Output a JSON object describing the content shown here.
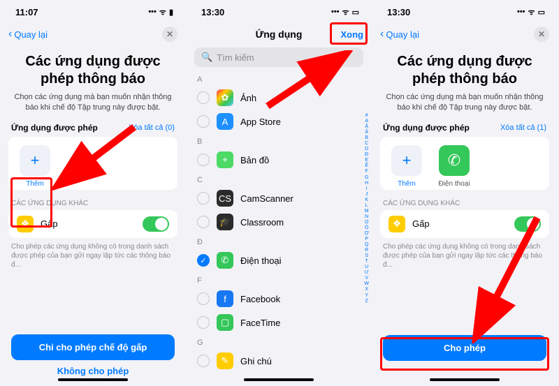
{
  "screen1": {
    "time": "11:07",
    "back": "Quay lại",
    "title": "Các ứng dụng được phép thông báo",
    "subtitle": "Chọn các ứng dụng mà bạn muốn nhận thông báo khi chế độ Tập trung này được bật.",
    "allowed_label": "Ứng dụng được phép",
    "clear_all": "Xóa tất cả (0)",
    "add_label": "Thêm",
    "other_apps": "CÁC ỨNG DỤNG KHÁC",
    "gap_label": "Gấp",
    "footnote": "Cho phép các ứng dụng không có trong danh sách được phép của bạn gửi ngay lập tức các thông báo đ...",
    "primary_btn": "Chỉ cho phép chế độ gấp",
    "secondary_btn": "Không cho phép"
  },
  "screen2": {
    "time": "13:30",
    "title": "Ứng dụng",
    "done": "Xong",
    "search_ph": "Tìm kiếm",
    "index": "# A Ă Â B C D Đ E Ê F G H I J K L M N O Ô Ơ P Q R S T U Ư V W X Y Z",
    "groups": [
      {
        "letter": "A",
        "items": [
          {
            "name": "Ảnh",
            "bg": "linear-gradient(135deg,#ff2d55,#ffcc00,#34c759,#5ac8fa)",
            "checked": false,
            "glyph": "✿"
          },
          {
            "name": "App Store",
            "bg": "#1e90ff",
            "checked": false,
            "glyph": "A"
          }
        ]
      },
      {
        "letter": "B",
        "items": [
          {
            "name": "Bản đồ",
            "bg": "#4cd964",
            "checked": false,
            "glyph": "⌖"
          }
        ]
      },
      {
        "letter": "C",
        "items": [
          {
            "name": "CamScanner",
            "bg": "#2b2b2b",
            "checked": false,
            "glyph": "CS"
          },
          {
            "name": "Classroom",
            "bg": "#2b2b2b",
            "checked": false,
            "glyph": "🎓"
          }
        ]
      },
      {
        "letter": "Đ",
        "items": [
          {
            "name": "Điện thoại",
            "bg": "#34c759",
            "checked": true,
            "glyph": "✆"
          }
        ]
      },
      {
        "letter": "F",
        "items": [
          {
            "name": "Facebook",
            "bg": "#1877f2",
            "checked": false,
            "glyph": "f"
          },
          {
            "name": "FaceTime",
            "bg": "#34c759",
            "checked": false,
            "glyph": "▢"
          }
        ]
      },
      {
        "letter": "G",
        "items": [
          {
            "name": "Ghi chú",
            "bg": "#ffcc00",
            "checked": false,
            "glyph": "✎"
          }
        ]
      }
    ]
  },
  "screen3": {
    "time": "13:30",
    "back": "Quay lại",
    "title": "Các ứng dụng được phép thông báo",
    "subtitle": "Chọn các ứng dụng mà bạn muốn nhận thông báo khi chế độ Tập trung này được bật.",
    "allowed_label": "Ứng dụng được phép",
    "clear_all": "Xóa tất cả (1)",
    "add_label": "Thêm",
    "phone_label": "Điện thoại",
    "other_apps": "CÁC ỨNG DỤNG KHÁC",
    "gap_label": "Gấp",
    "footnote": "Cho phép các ứng dụng không có trong danh sách được phép của bạn gửi ngay lập tức các thông báo đ...",
    "primary_btn": "Cho phép"
  }
}
